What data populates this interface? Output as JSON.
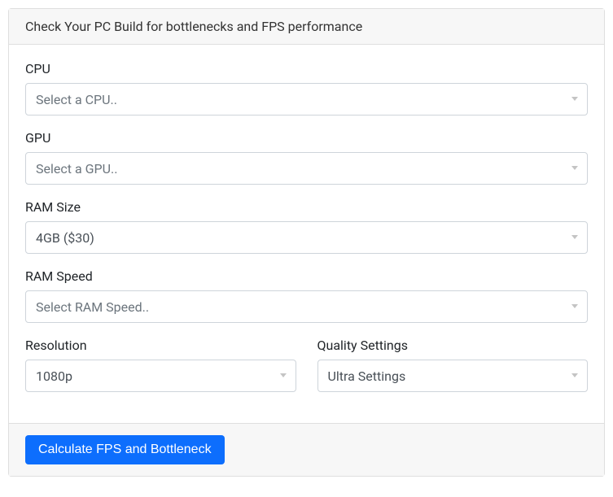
{
  "header": {
    "title": "Check Your PC Build for bottlenecks and FPS performance"
  },
  "form": {
    "cpu": {
      "label": "CPU",
      "placeholder": "Select a CPU..",
      "value": ""
    },
    "gpu": {
      "label": "GPU",
      "placeholder": "Select a GPU..",
      "value": ""
    },
    "ram_size": {
      "label": "RAM Size",
      "value": "4GB ($30)"
    },
    "ram_speed": {
      "label": "RAM Speed",
      "placeholder": "Select RAM Speed..",
      "value": ""
    },
    "resolution": {
      "label": "Resolution",
      "value": "1080p"
    },
    "quality": {
      "label": "Quality Settings",
      "value": "Ultra Settings"
    }
  },
  "footer": {
    "submit_label": "Calculate FPS and Bottleneck"
  }
}
